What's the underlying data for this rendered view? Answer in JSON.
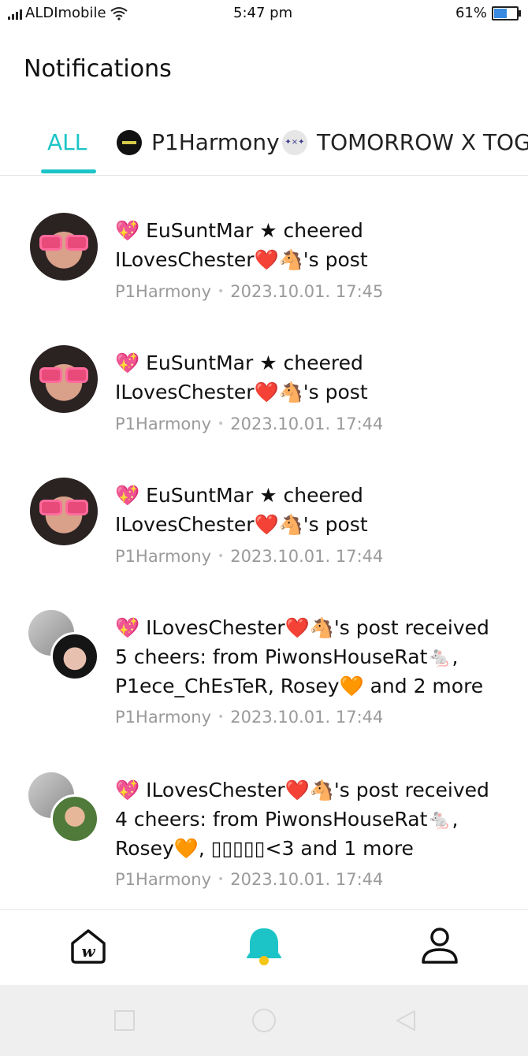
{
  "status_bar": {
    "carrier": "ALDImobile",
    "time": "5:47 pm",
    "battery": "61%",
    "battery_level": 0.61
  },
  "header": {
    "title": "Notifications"
  },
  "tabs": [
    {
      "label": "ALL",
      "active": true
    },
    {
      "label": "P1Harmony",
      "active": false
    },
    {
      "label": "TOMORROW X TOG",
      "active": false
    }
  ],
  "notifications": [
    {
      "message": "💖 EuSuntMar ★ cheered ILovesChester❤️🐴's post",
      "source": "P1Harmony",
      "timestamp": "2023.10.01. 17:45"
    },
    {
      "message": "💖 EuSuntMar ★ cheered ILovesChester❤️🐴's post",
      "source": "P1Harmony",
      "timestamp": "2023.10.01. 17:44"
    },
    {
      "message": "💖 EuSuntMar ★ cheered ILovesChester❤️🐴's post",
      "source": "P1Harmony",
      "timestamp": "2023.10.01. 17:44"
    },
    {
      "message": "💖 ILovesChester❤️🐴's post received 5 cheers: from PiwonsHouseRat🐁, P1ece_ChEsTeR, Rosey🧡 and 2 more",
      "source": "P1Harmony",
      "timestamp": "2023.10.01. 17:44"
    },
    {
      "message": "💖 ILovesChester❤️🐴's post received 4 cheers: from PiwonsHouseRat🐁, Rosey🧡, ▯▯▯▯▯<3 and 1 more",
      "source": "P1Harmony",
      "timestamp": "2023.10.01. 17:44"
    }
  ],
  "bottom_nav": [
    {
      "icon": "weverse-home-icon"
    },
    {
      "icon": "bell-icon"
    },
    {
      "icon": "profile-icon"
    }
  ],
  "colors": {
    "accent": "#1cc4c7",
    "bell_yellow": "#f5c518"
  }
}
